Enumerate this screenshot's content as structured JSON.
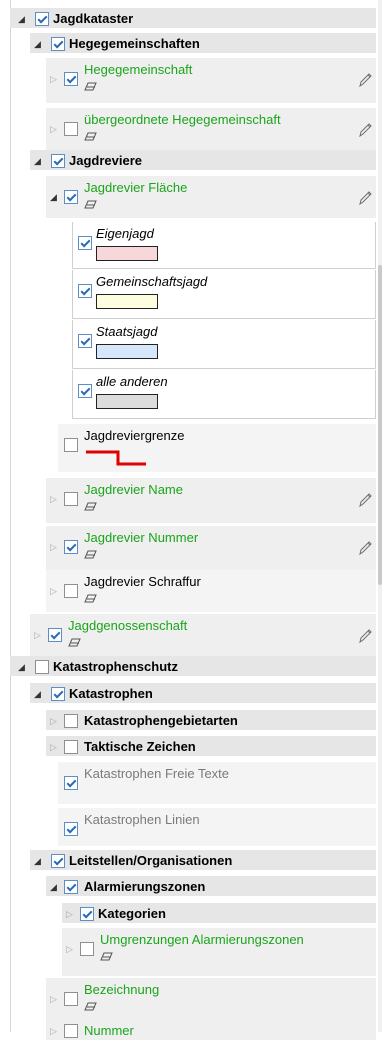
{
  "tree": [
    {
      "id": "jagdkataster",
      "label": "Jagdkataster",
      "arrow": "exp",
      "checked": true,
      "style": "bold"
    },
    {
      "id": "hegegemeinschaften",
      "label": "Hegegemeinschaften",
      "arrow": "exp",
      "checked": true,
      "style": "bold"
    },
    {
      "id": "hegegemeinschaft",
      "label": "Hegegemeinschaft",
      "arrow": "col",
      "checked": true,
      "style": "green",
      "eraser": true,
      "pencil": true
    },
    {
      "id": "uebergeordnete-hegegemeinschaft",
      "label": "übergeordnete Hegegemeinschaft",
      "arrow": "col",
      "checked": false,
      "style": "green",
      "eraser": true,
      "pencil": true
    },
    {
      "id": "jagdreviere",
      "label": "Jagdreviere",
      "arrow": "exp",
      "checked": true,
      "style": "bold"
    },
    {
      "id": "jagdrevier-flaeche",
      "label": "Jagdrevier Fläche",
      "arrow": "exp",
      "checked": true,
      "style": "green",
      "eraser": true,
      "pencil": true
    },
    {
      "id": "eigenjagd",
      "label": "Eigenjagd",
      "checked": true,
      "style": "italic",
      "swatch": "#f8d7da"
    },
    {
      "id": "gemeinschaftsjagd",
      "label": "Gemeinschaftsjagd",
      "checked": true,
      "style": "italic",
      "swatch": "#fdfde0"
    },
    {
      "id": "staatsjagd",
      "label": "Staatsjagd",
      "checked": true,
      "style": "italic",
      "swatch": "#d6e7fb"
    },
    {
      "id": "alle-anderen",
      "label": "alle anderen",
      "checked": true,
      "style": "italic",
      "swatch": "#dcdcdc"
    },
    {
      "id": "jagdreviergrenze",
      "label": "Jagdreviergrenze",
      "checked": false,
      "style": "normal",
      "linesample": "#e00000"
    },
    {
      "id": "jagdrevier-name",
      "label": "Jagdrevier Name",
      "arrow": "col",
      "checked": false,
      "style": "green",
      "eraser": true,
      "pencil": true
    },
    {
      "id": "jagdrevier-nummer",
      "label": "Jagdrevier Nummer",
      "arrow": "col",
      "checked": true,
      "style": "green",
      "eraser": true,
      "pencil": true
    },
    {
      "id": "jagdrevier-schraffur",
      "label": "Jagdrevier Schraffur",
      "arrow": "col",
      "checked": false,
      "style": "normal",
      "eraser": true
    },
    {
      "id": "jagdgenossenschaft",
      "label": "Jagdgenossenschaft",
      "arrow": "col",
      "checked": true,
      "style": "green",
      "eraser": true,
      "pencil": true
    },
    {
      "id": "katastrophenschutz",
      "label": "Katastrophenschutz",
      "arrow": "exp",
      "checked": false,
      "style": "bold"
    },
    {
      "id": "katastrophen",
      "label": "Katastrophen",
      "arrow": "exp",
      "checked": true,
      "style": "bold"
    },
    {
      "id": "katastrophengebietarten",
      "label": "Katastrophengebietarten",
      "arrow": "col",
      "checked": false,
      "style": "bold"
    },
    {
      "id": "taktische-zeichen",
      "label": "Taktische Zeichen",
      "arrow": "col",
      "checked": false,
      "style": "bold"
    },
    {
      "id": "katastrophen-freie-texte",
      "label": "Katastrophen Freie Texte",
      "checked": true,
      "style": "grey"
    },
    {
      "id": "katastrophen-linien",
      "label": "Katastrophen Linien",
      "checked": true,
      "style": "grey"
    },
    {
      "id": "leitstellen",
      "label": "Leitstellen/Organisationen",
      "arrow": "exp",
      "checked": true,
      "style": "bold"
    },
    {
      "id": "alarmierungszonen",
      "label": "Alarmierungszonen",
      "arrow": "exp",
      "checked": true,
      "style": "bold"
    },
    {
      "id": "kategorien",
      "label": "Kategorien",
      "arrow": "col",
      "checked": true,
      "style": "bold"
    },
    {
      "id": "umgrenzungen",
      "label": "Umgrenzungen Alarmierungszonen",
      "arrow": "col",
      "checked": false,
      "style": "green",
      "eraser": true
    },
    {
      "id": "bezeichnung",
      "label": "Bezeichnung",
      "arrow": "col",
      "checked": false,
      "style": "green",
      "eraser": true
    },
    {
      "id": "nummer",
      "label": "Nummer",
      "arrow": "col",
      "checked": false,
      "style": "green"
    }
  ]
}
